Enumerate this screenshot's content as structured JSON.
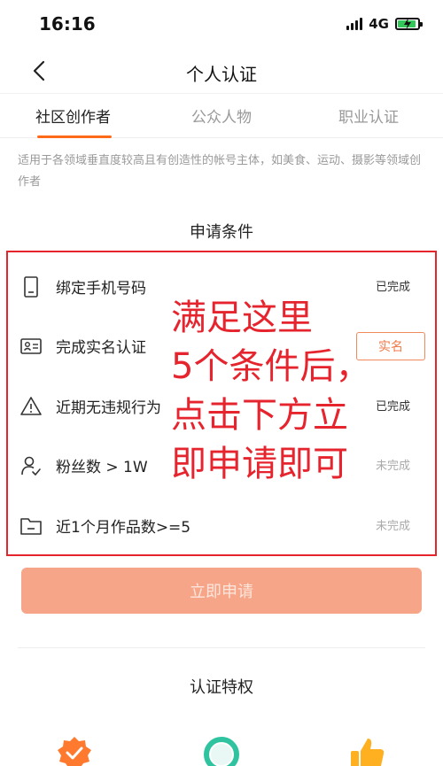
{
  "status_bar": {
    "time": "16:16",
    "network": "4G"
  },
  "nav": {
    "title": "个人认证"
  },
  "tabs": [
    {
      "label": "社区创作者",
      "active": true
    },
    {
      "label": "公众人物",
      "active": false
    },
    {
      "label": "职业认证",
      "active": false
    }
  ],
  "description": "适用于各领域垂直度较高且有创造性的帐号主体，如美食、运动、摄影等领域创作者",
  "conditions": {
    "title": "申请条件",
    "items": [
      {
        "label": "绑定手机号码",
        "status": "已完成",
        "icon": "phone-icon"
      },
      {
        "label": "完成实名认证",
        "button": "实名",
        "icon": "id-card-icon"
      },
      {
        "label": "近期无违规行为",
        "status": "已完成",
        "icon": "warning-icon"
      },
      {
        "label": "粉丝数 > 1W",
        "status": "未完成",
        "icon": "follower-icon"
      },
      {
        "label": "近1个月作品数>=5",
        "status": "未完成",
        "icon": "folder-icon"
      }
    ]
  },
  "annotation": {
    "lines": [
      "满足这里",
      "5个条件后，",
      "点击下方立",
      "即申请即可"
    ]
  },
  "apply_button": "立即申请",
  "privileges": {
    "title": "认证特权"
  },
  "colors": {
    "accent": "#ff6a1a",
    "annotation": "#e6242e",
    "apply_disabled": "#f6a588"
  }
}
